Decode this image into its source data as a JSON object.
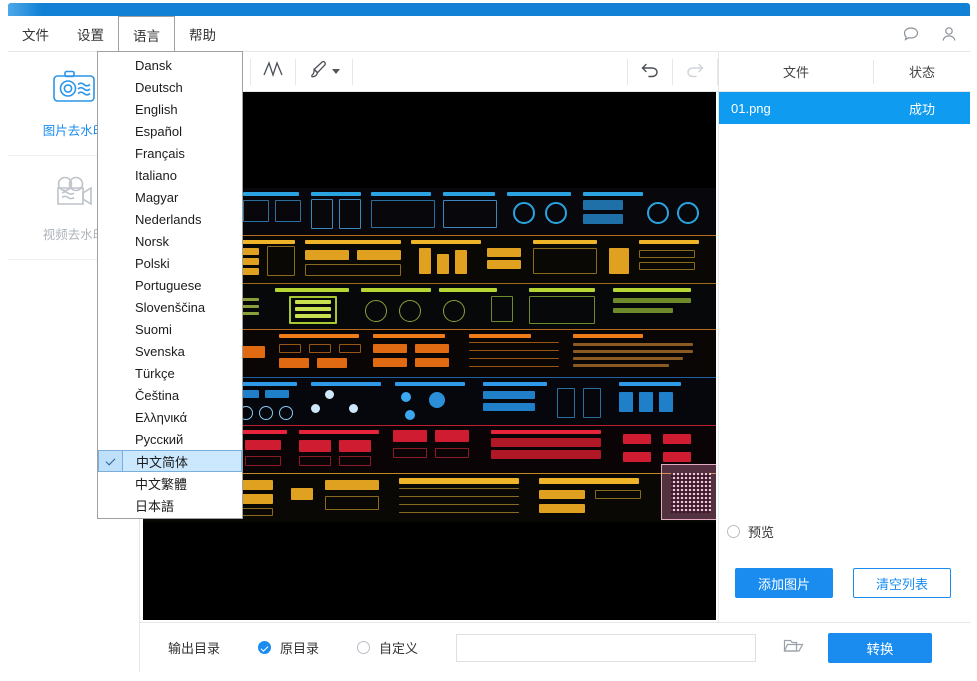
{
  "window": {
    "accent_color": "#1081d4"
  },
  "menubar": {
    "items": [
      {
        "label": "文件",
        "name": "menu-file"
      },
      {
        "label": "设置",
        "name": "menu-settings"
      },
      {
        "label": "语言",
        "name": "menu-language"
      },
      {
        "label": "帮助",
        "name": "menu-help"
      }
    ],
    "open_menu": "语言",
    "right_icons": [
      {
        "name": "feedback-icon"
      },
      {
        "name": "account-icon"
      }
    ]
  },
  "language_menu": {
    "options": [
      "Dansk",
      "Deutsch",
      "English",
      "Español",
      "Français",
      "Italiano",
      "Magyar",
      "Nederlands",
      "Norsk",
      "Polski",
      "Portuguese",
      "Slovenščina",
      "Suomi",
      "Svenska",
      "Türkçe",
      "Čeština",
      "Ελληνικά",
      "Русский",
      "中文简体",
      "中文繁體",
      "日本語"
    ],
    "selected": "中文简体",
    "highlight_color": "#cce8ff"
  },
  "sidebar": {
    "items": [
      {
        "label": "图片去水印",
        "icon": "camera-wave-icon",
        "active": true
      },
      {
        "label": "视频去水印",
        "icon": "video-camera-wave-icon",
        "active": false
      }
    ]
  },
  "toolbar": {
    "tools": [
      {
        "name": "polyline-tool",
        "icon": "polyline-icon"
      },
      {
        "name": "brush-tool",
        "icon": "brush-icon",
        "has_dropdown": true
      }
    ],
    "undo": {
      "label": "撤销",
      "icon": "undo-icon",
      "enabled": true
    },
    "redo": {
      "label": "重做",
      "icon": "redo-icon",
      "enabled": false
    }
  },
  "filepanel": {
    "columns": {
      "file": "文件",
      "status": "状态"
    },
    "rows": [
      {
        "filename": "01.png",
        "status": "成功",
        "selected": true
      }
    ],
    "preview": {
      "label": "预览",
      "checked": false
    },
    "add_button": "添加图片",
    "clear_button": "清空列表",
    "selected_row_color": "#0e9bf0"
  },
  "bottombar": {
    "output_label": "输出目录",
    "original_dir": {
      "label": "原目录",
      "checked": true
    },
    "custom_dir": {
      "label": "自定义",
      "checked": false
    },
    "path_value": "",
    "path_placeholder": "",
    "browse_icon": "folder-open-icon",
    "convert_button": "转换"
  },
  "canvas": {
    "image_name": "01.png",
    "background": "#000000",
    "selection": {
      "name": "watermark-selection",
      "content": "qr-code-watermark"
    },
    "bands": [
      {
        "accent": "#2aa3e0",
        "sep": "#b86a1e"
      },
      {
        "accent": "#f0b429",
        "sep": "#9c6b1a"
      },
      {
        "accent": "#b5d633",
        "sep": "#b86a1e"
      },
      {
        "accent": "#f07c19",
        "sep": "#1f5fa0"
      },
      {
        "accent": "#2f9ae8",
        "sep": "#b82030"
      },
      {
        "accent": "#e8233c",
        "sep": "#c08a20"
      },
      {
        "accent": "#f0b429",
        "sep": "#3a3a3a"
      }
    ]
  }
}
